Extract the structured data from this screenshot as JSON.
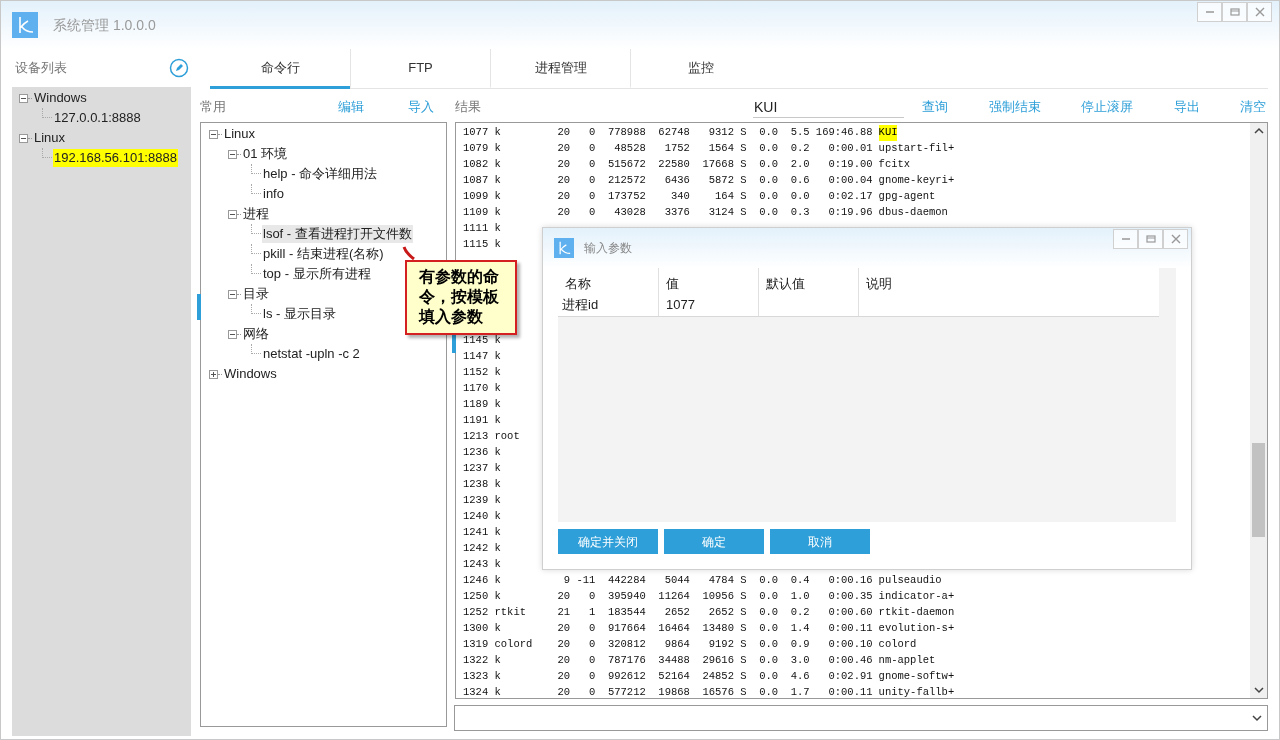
{
  "window": {
    "title": "系统管理 1.0.0.0"
  },
  "devices": {
    "title": "设备列表",
    "items": [
      {
        "label": "Windows",
        "expanded": true,
        "selected": false,
        "children": [
          {
            "label": "127.0.0.1:8888",
            "selected": false
          }
        ]
      },
      {
        "label": "Linux",
        "expanded": true,
        "selected": false,
        "children": [
          {
            "label": "192.168.56.101:8888",
            "selected": true
          }
        ]
      }
    ]
  },
  "tabs": [
    {
      "label": "命令行",
      "selected": true
    },
    {
      "label": "FTP",
      "selected": false
    },
    {
      "label": "进程管理",
      "selected": false
    },
    {
      "label": "监控",
      "selected": false
    }
  ],
  "commands": {
    "title": "常用",
    "actions": [
      "编辑",
      "导入"
    ],
    "items": [
      {
        "label": "Linux",
        "expanded": true,
        "selected": false,
        "children": [
          {
            "label": "01 环境",
            "expanded": true,
            "selected": false,
            "children": [
              {
                "label": "help - 命令详细用法",
                "selected": false
              },
              {
                "label": "info",
                "selected": false
              }
            ]
          },
          {
            "label": "进程",
            "expanded": true,
            "selected": false,
            "children": [
              {
                "label": "lsof - 查看进程打开文件数",
                "selected": true
              },
              {
                "label": "pkill - 结束进程(名称)",
                "selected": false
              },
              {
                "label": "top - 显示所有进程",
                "selected": false
              }
            ]
          },
          {
            "label": "目录",
            "expanded": true,
            "selected": false,
            "children": [
              {
                "label": "ls - 显示目录",
                "selected": false
              }
            ]
          },
          {
            "label": "网络",
            "expanded": true,
            "selected": false,
            "children": [
              {
                "label": "netstat -upln -c 2",
                "selected": false
              }
            ]
          }
        ]
      },
      {
        "label": "Windows",
        "expanded": false,
        "selected": false
      }
    ]
  },
  "results": {
    "title": "结果",
    "search": {
      "value": "KUI"
    },
    "actions": [
      "查询",
      "强制结束",
      "停止滚屏",
      "导出",
      "清空"
    ],
    "lines_top": [
      {
        "text": "1077 k         20   0  778988  62748   9312 S  0.0  5.5 169:46.88",
        "command": "KUI",
        "highlighted": true
      },
      {
        "text": "1079 k         20   0   48528   1752   1564 S  0.0  0.2   0:00.01",
        "command": "upstart-fil+",
        "highlighted": false
      },
      {
        "text": "1082 k         20   0  515672  22580  17668 S  0.0  2.0   0:19.00",
        "command": "fcitx",
        "highlighted": false
      },
      {
        "text": "1087 k         20   0  212572   6436   5872 S  0.0  0.6   0:00.04",
        "command": "gnome-keyri+",
        "highlighted": false
      },
      {
        "text": "1099 k         20   0  173752    340    164 S  0.0  0.0   0:02.17",
        "command": "gpg-agent",
        "highlighted": false
      },
      {
        "text": "1109 k         20   0   43028   3376   3124 S  0.0  0.3   0:19.96",
        "command": "dbus-daemon",
        "highlighted": false
      },
      {
        "text": "1111 k"
      },
      {
        "text": "1115 k"
      }
    ],
    "lines_bottom": [
      {
        "text": "1145 k"
      },
      {
        "text": "1147 k"
      },
      {
        "text": "1152 k"
      },
      {
        "text": "1170 k"
      },
      {
        "text": "1189 k"
      },
      {
        "text": "1191 k"
      },
      {
        "text": "1213 root"
      },
      {
        "text": "1236 k"
      },
      {
        "text": "1237 k"
      },
      {
        "text": "1238 k"
      },
      {
        "text": "1239 k"
      },
      {
        "text": "1240 k"
      },
      {
        "text": "1241 k"
      },
      {
        "text": "1242 k"
      },
      {
        "text": "1243 k"
      },
      {
        "text": "1246 k          9 -11  442284   5044   4784 S  0.0  0.4   0:00.16",
        "command": "pulseaudio",
        "highlighted": false
      },
      {
        "text": "1250 k         20   0  395940  11264  10956 S  0.0  1.0   0:00.35",
        "command": "indicator-a+",
        "highlighted": false
      },
      {
        "text": "1252 rtkit     21   1  183544   2652   2652 S  0.0  0.2   0:00.60",
        "command": "rtkit-daemon",
        "highlighted": false
      },
      {
        "text": "1300 k         20   0  917664  16464  13480 S  0.0  1.4   0:00.11",
        "command": "evolution-s+",
        "highlighted": false
      },
      {
        "text": "1319 colord    20   0  320812   9864   9192 S  0.0  0.9   0:00.10",
        "command": "colord",
        "highlighted": false
      },
      {
        "text": "1322 k         20   0  787176  34488  29616 S  0.0  3.0   0:00.46",
        "command": "nm-applet",
        "highlighted": false
      },
      {
        "text": "1323 k         20   0  992612  52164  24852 S  0.0  4.6   0:02.91",
        "command": "gnome-softw+",
        "highlighted": false
      },
      {
        "text": "1324 k         20   0  577212  19868  16576 S  0.0  1.7   0:00.11",
        "command": "unity-fallb+",
        "highlighted": false
      }
    ]
  },
  "callout": {
    "text": "有参数的命令，按模板填入参数"
  },
  "dialog": {
    "title": "输入参数",
    "columns": [
      "名称",
      "值",
      "默认值",
      "说明"
    ],
    "rows": [
      [
        "进程id",
        "1077"
      ]
    ],
    "buttons": [
      "确定并关闭",
      "确定",
      "取消"
    ]
  }
}
